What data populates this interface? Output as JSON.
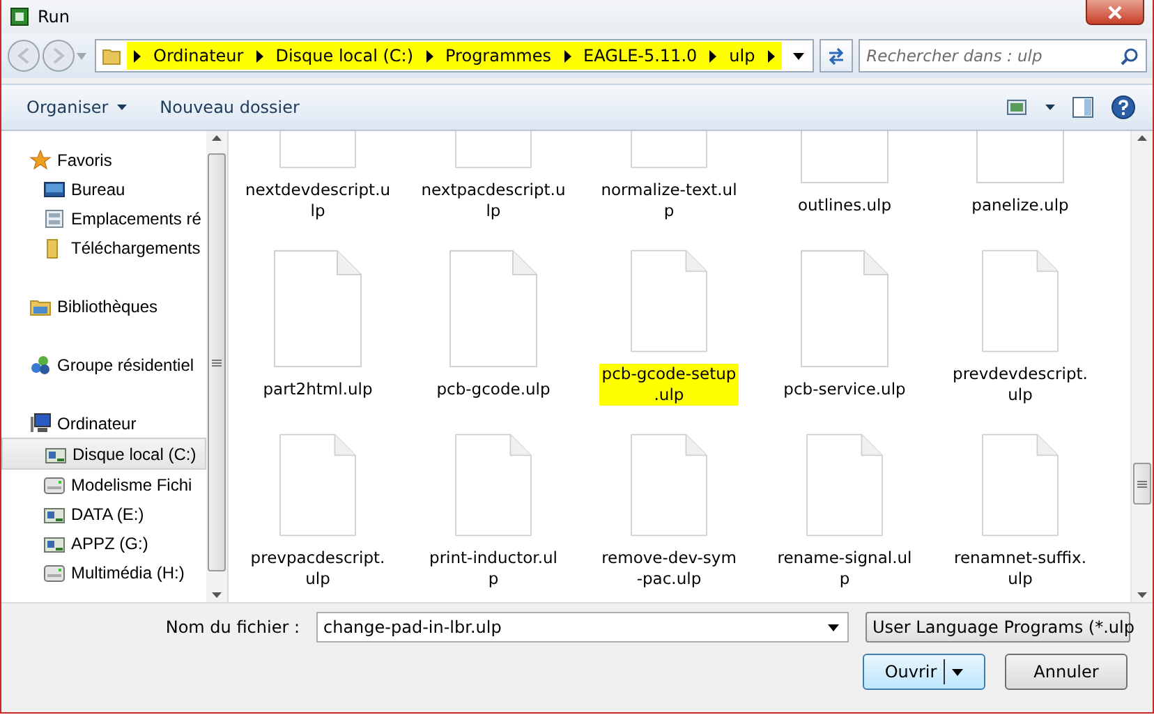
{
  "window": {
    "title": "Run"
  },
  "address": {
    "highlighted": true,
    "crumbs": [
      "Ordinateur",
      "Disque local (C:)",
      "Programmes",
      "EAGLE-5.11.0",
      "ulp"
    ]
  },
  "search": {
    "placeholder": "Rechercher dans : ulp"
  },
  "toolbar": {
    "buttons": [
      {
        "label": "Organiser",
        "dropdown": true
      },
      {
        "label": "Nouveau dossier",
        "dropdown": false
      }
    ]
  },
  "sidebar": {
    "items": [
      {
        "kind": "group",
        "label": "Favoris",
        "selected": false
      },
      {
        "kind": "item",
        "label": "Bureau",
        "selected": false
      },
      {
        "kind": "item",
        "label": "Emplacements ré",
        "selected": false
      },
      {
        "kind": "item",
        "label": "Téléchargements",
        "selected": false
      },
      {
        "kind": "group",
        "label": "Bibliothèques",
        "selected": false
      },
      {
        "kind": "group",
        "label": "Groupe résidentiel",
        "selected": false
      },
      {
        "kind": "group",
        "label": "Ordinateur",
        "selected": false
      },
      {
        "kind": "item",
        "label": "Disque local (C:)",
        "selected": true
      },
      {
        "kind": "item",
        "label": "Modelisme Fichi",
        "selected": false
      },
      {
        "kind": "item",
        "label": "DATA (E:)",
        "selected": false
      },
      {
        "kind": "item",
        "label": "APPZ (G:)",
        "selected": false
      },
      {
        "kind": "item",
        "label": "Multimédia (H:)",
        "selected": false
      }
    ]
  },
  "files": [
    {
      "lines": [
        "nextdevdescript.u",
        "lp"
      ],
      "highlighted": false
    },
    {
      "lines": [
        "nextpacdescript.u",
        "lp"
      ],
      "highlighted": false
    },
    {
      "lines": [
        "normalize-text.ul",
        "p"
      ],
      "highlighted": false
    },
    {
      "lines": [
        "outlines.ulp"
      ],
      "highlighted": false
    },
    {
      "lines": [
        "panelize.ulp"
      ],
      "highlighted": false
    },
    {
      "lines": [
        "part2html.ulp"
      ],
      "highlighted": false
    },
    {
      "lines": [
        "pcb-gcode.ulp"
      ],
      "highlighted": false
    },
    {
      "lines": [
        "pcb-gcode-setup",
        ".ulp"
      ],
      "highlighted": true
    },
    {
      "lines": [
        "pcb-service.ulp"
      ],
      "highlighted": false
    },
    {
      "lines": [
        "prevdevdescript.",
        "ulp"
      ],
      "highlighted": false
    },
    {
      "lines": [
        "prevpacdescript.",
        "ulp"
      ],
      "highlighted": false
    },
    {
      "lines": [
        "print-inductor.ul",
        "p"
      ],
      "highlighted": false
    },
    {
      "lines": [
        "remove-dev-sym",
        "-pac.ulp"
      ],
      "highlighted": false
    },
    {
      "lines": [
        "rename-signal.ul",
        "p"
      ],
      "highlighted": false
    },
    {
      "lines": [
        "renamnet-suffix.",
        "ulp"
      ],
      "highlighted": false
    }
  ],
  "filename": {
    "label": "Nom du fichier :",
    "value": "change-pad-in-lbr.ulp"
  },
  "filetype": {
    "value": "User Language Programs (*.ulp"
  },
  "buttons": [
    {
      "label": "Ouvrir",
      "kind": "split",
      "default": true
    },
    {
      "label": "Annuler",
      "kind": "plain",
      "default": false
    }
  ]
}
